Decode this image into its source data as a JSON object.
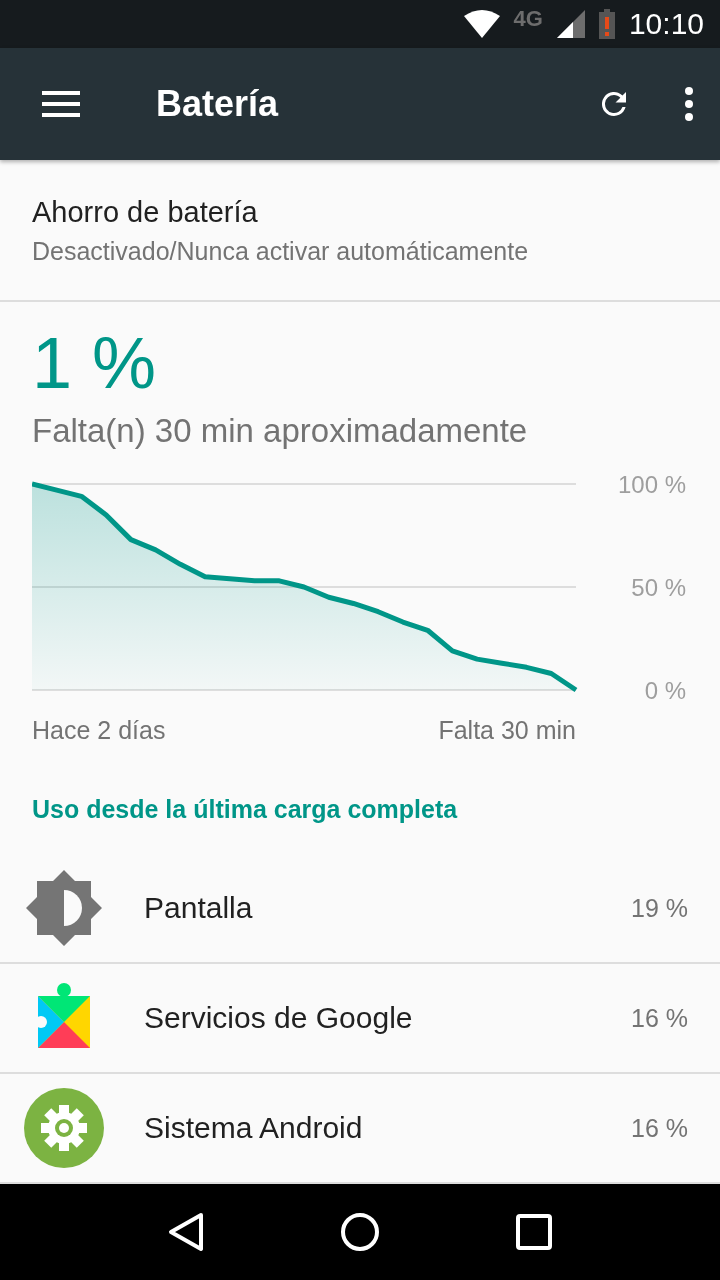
{
  "status_bar": {
    "network": "4G",
    "time": "10:10"
  },
  "app_bar": {
    "title": "Batería"
  },
  "saver": {
    "title": "Ahorro de batería",
    "summary": "Desactivado/Nunca activar automáticamente"
  },
  "battery": {
    "percent": "1 %",
    "remaining": "Falta(n) 30 min aproximadamente"
  },
  "chart": {
    "start_label": "Hace 2 días",
    "end_label": "Falta 30 min",
    "chart_data": {
      "type": "area",
      "categories": [
        null,
        null,
        null,
        null,
        null,
        null,
        null,
        null,
        null,
        null,
        null,
        null,
        null,
        null,
        null,
        null,
        null,
        null,
        null,
        null,
        null,
        null,
        null
      ],
      "series": [
        {
          "color": "#009688",
          "values": [
            100,
            97,
            94,
            85,
            73,
            68,
            61,
            55,
            54,
            53,
            53,
            50,
            45,
            42,
            38,
            33,
            29,
            19,
            15,
            13,
            11,
            8,
            0
          ]
        }
      ],
      "ylim": [
        0,
        100
      ],
      "yticks": [
        {
          "value": 0,
          "label": "0 %"
        },
        {
          "value": 50,
          "label": "50 %"
        },
        {
          "value": 100,
          "label": "100 %"
        }
      ]
    }
  },
  "usage": {
    "header": "Uso desde la última carga completa",
    "items": [
      {
        "kind": "display",
        "name": "Pantalla",
        "percent": "19 %"
      },
      {
        "kind": "services",
        "name": "Servicios de Google",
        "percent": "16 %"
      },
      {
        "kind": "system",
        "name": "Sistema Android",
        "percent": "16 %"
      }
    ]
  }
}
